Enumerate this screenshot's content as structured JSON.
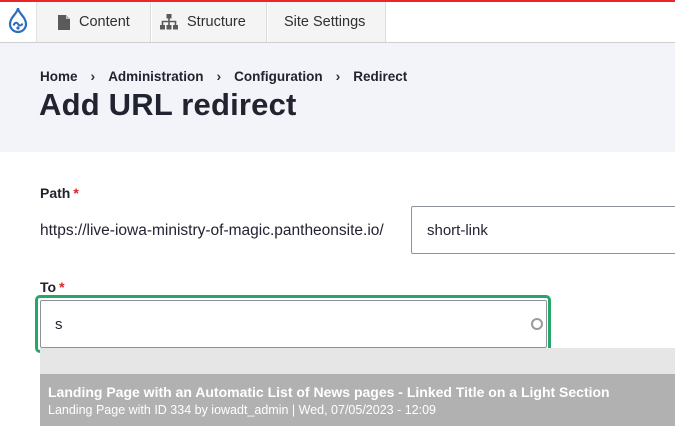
{
  "toolbar": {
    "logo_icon": "drupal-drop-icon",
    "items": [
      {
        "label": "Content",
        "icon": "file-icon"
      },
      {
        "label": "Structure",
        "icon": "sitemap-icon"
      },
      {
        "label": "Site Settings"
      }
    ],
    "accent_color": "#e8262b"
  },
  "breadcrumb": [
    "Home",
    "Administration",
    "Configuration",
    "Redirect"
  ],
  "page": {
    "title": "Add URL redirect"
  },
  "form": {
    "path": {
      "label": "Path",
      "required_mark": "*",
      "prefix": "https://live-iowa-ministry-of-magic.pantheonsite.io/",
      "value": "short-link"
    },
    "to": {
      "label": "To",
      "required_mark": "*",
      "value": "s",
      "focus_color": "#26a769"
    }
  },
  "autocomplete": {
    "items": [
      {
        "title": "Landing Page with an Automatic List of News pages - Linked Title on a Light Section",
        "meta": "Landing Page with ID 334 by iowadt_admin | Wed, 07/05/2023 - 12:09"
      }
    ]
  }
}
